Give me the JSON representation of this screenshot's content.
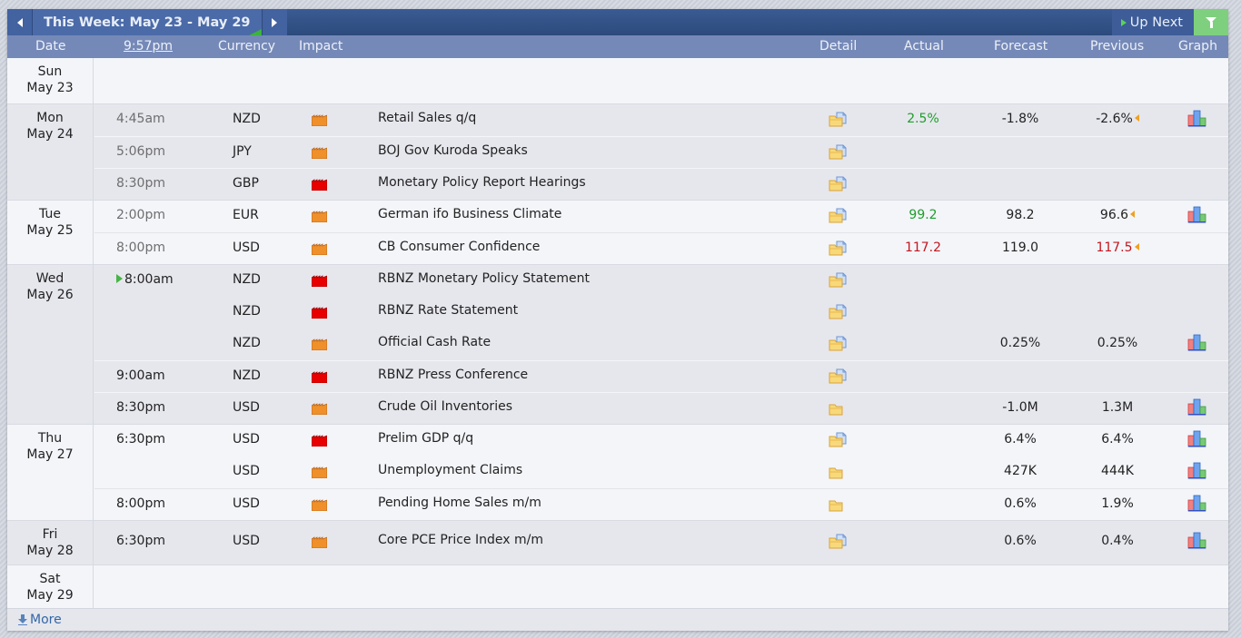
{
  "nav": {
    "week_title": "This Week: May 23 - May 29",
    "up_next_label": "Up Next"
  },
  "header": {
    "date": "Date",
    "time": "9:57pm",
    "currency": "Currency",
    "impact": "Impact",
    "detail": "Detail",
    "actual": "Actual",
    "forecast": "Forecast",
    "previous": "Previous",
    "graph": "Graph"
  },
  "colors": {
    "high_impact": "#e80000",
    "medium_impact": "#f0902a",
    "better": "#1e9e2a",
    "worse": "#c2161c",
    "up_next_green": "#5bd05b"
  },
  "days": [
    {
      "dow": "Sun",
      "date": "May 23",
      "events": []
    },
    {
      "dow": "Mon",
      "date": "May 24",
      "events": [
        {
          "time": "4:45am",
          "currency": "NZD",
          "impact": "medium",
          "event": "Retail Sales q/q",
          "detail": "folder-doc-icon",
          "actual": "2.5%",
          "actual_status": "better",
          "forecast": "-1.8%",
          "previous": "-2.6%",
          "previous_revised": true,
          "previous_status": "",
          "graph": true,
          "past": true
        },
        {
          "time": "5:06pm",
          "currency": "JPY",
          "impact": "medium",
          "event": "BOJ Gov Kuroda Speaks",
          "detail": "folder-doc-icon",
          "actual": "",
          "forecast": "",
          "previous": "",
          "graph": false,
          "past": true
        },
        {
          "time": "8:30pm",
          "currency": "GBP",
          "impact": "high",
          "event": "Monetary Policy Report Hearings",
          "detail": "folder-doc-icon",
          "actual": "",
          "forecast": "",
          "previous": "",
          "graph": false,
          "past": true
        }
      ]
    },
    {
      "dow": "Tue",
      "date": "May 25",
      "events": [
        {
          "time": "2:00pm",
          "currency": "EUR",
          "impact": "medium",
          "event": "German ifo Business Climate",
          "detail": "folder-doc-icon",
          "actual": "99.2",
          "actual_status": "better",
          "forecast": "98.2",
          "previous": "96.6",
          "previous_revised": true,
          "previous_status": "",
          "graph": true,
          "past": true
        },
        {
          "time": "8:00pm",
          "currency": "USD",
          "impact": "medium",
          "event": "CB Consumer Confidence",
          "detail": "folder-doc-icon",
          "actual": "117.2",
          "actual_status": "worse",
          "forecast": "119.0",
          "previous": "117.5",
          "previous_revised": true,
          "previous_status": "worse",
          "graph": false,
          "past": true
        }
      ]
    },
    {
      "dow": "Wed",
      "date": "May 26",
      "events": [
        {
          "time": "8:00am",
          "up_next": true,
          "currency": "NZD",
          "impact": "high",
          "event": "RBNZ Monetary Policy Statement",
          "detail": "folder-doc-icon",
          "actual": "",
          "forecast": "",
          "previous": "",
          "graph": false
        },
        {
          "time": "",
          "currency": "NZD",
          "impact": "high",
          "event": "RBNZ Rate Statement",
          "detail": "folder-doc-icon",
          "actual": "",
          "forecast": "",
          "previous": "",
          "graph": false
        },
        {
          "time": "",
          "currency": "NZD",
          "impact": "medium",
          "event": "Official Cash Rate",
          "detail": "folder-doc-icon",
          "actual": "",
          "forecast": "0.25%",
          "previous": "0.25%",
          "graph": true
        },
        {
          "time": "9:00am",
          "currency": "NZD",
          "impact": "high",
          "event": "RBNZ Press Conference",
          "detail": "folder-doc-icon",
          "actual": "",
          "forecast": "",
          "previous": "",
          "graph": false
        },
        {
          "time": "8:30pm",
          "currency": "USD",
          "impact": "medium",
          "event": "Crude Oil Inventories",
          "detail": "folder-icon",
          "actual": "",
          "forecast": "-1.0M",
          "previous": "1.3M",
          "graph": true
        }
      ]
    },
    {
      "dow": "Thu",
      "date": "May 27",
      "events": [
        {
          "time": "6:30pm",
          "currency": "USD",
          "impact": "high",
          "event": "Prelim GDP q/q",
          "detail": "folder-doc-icon",
          "actual": "",
          "forecast": "6.4%",
          "previous": "6.4%",
          "graph": true
        },
        {
          "time": "",
          "currency": "USD",
          "impact": "medium",
          "event": "Unemployment Claims",
          "detail": "folder-icon",
          "actual": "",
          "forecast": "427K",
          "previous": "444K",
          "graph": true
        },
        {
          "time": "8:00pm",
          "currency": "USD",
          "impact": "medium",
          "event": "Pending Home Sales m/m",
          "detail": "folder-icon",
          "actual": "",
          "forecast": "0.6%",
          "previous": "1.9%",
          "graph": true
        }
      ]
    },
    {
      "dow": "Fri",
      "date": "May 28",
      "events": [
        {
          "time": "6:30pm",
          "currency": "USD",
          "impact": "medium",
          "event": "Core PCE Price Index m/m",
          "detail": "folder-doc-icon",
          "actual": "",
          "forecast": "0.6%",
          "previous": "0.4%",
          "graph": true
        }
      ]
    },
    {
      "dow": "Sat",
      "date": "May 29",
      "events": []
    }
  ],
  "footer": {
    "more_label": "More"
  }
}
